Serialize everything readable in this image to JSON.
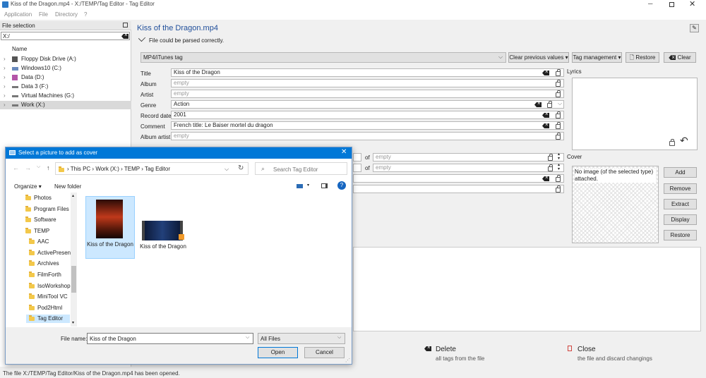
{
  "window": {
    "title": "Kiss of the Dragon.mp4 - X:/TEMP/Tag Editor - Tag Editor"
  },
  "menu": {
    "items": [
      "Application",
      "File",
      "Directory",
      "?"
    ]
  },
  "file_selection": {
    "title": "File selection",
    "path": "X:/",
    "column": "Name",
    "items": [
      {
        "label": "Floppy Disk Drive (A:)"
      },
      {
        "label": "Windows10 (C:)"
      },
      {
        "label": "Data (D:)"
      },
      {
        "label": "Data 3 (F:)"
      },
      {
        "label": "Virtual Machines (G:)"
      },
      {
        "label": "Work (X:)"
      }
    ]
  },
  "editor": {
    "filename": "Kiss of the Dragon.mp4",
    "parse_status": "File could be parsed correctly.",
    "tag_type": "MP4/iTunes tag",
    "buttons": {
      "clear_previous": "Clear previous values",
      "tag_management": "Tag management",
      "restore": "Restore",
      "clear": "Clear"
    },
    "fields": [
      {
        "label": "Title",
        "value": "Kiss of the Dragon"
      },
      {
        "label": "Album",
        "value": "empty"
      },
      {
        "label": "Artist",
        "value": "empty"
      },
      {
        "label": "Genre",
        "value": "Action"
      },
      {
        "label": "Record date",
        "value": "2001"
      },
      {
        "label": "Comment",
        "value": "French title: Le Baiser mortel du dragon"
      },
      {
        "label": "Album artist",
        "value": "empty"
      }
    ],
    "of_label": "of",
    "empty": "empty",
    "lyrics_label": "Lyrics",
    "cover": {
      "label": "Cover",
      "no_image": "No image (of the selected type) attached.",
      "buttons": [
        "Add",
        "Remove",
        "Extract",
        "Display",
        "Restore"
      ]
    },
    "delete": {
      "title": "Delete",
      "subtitle": "all tags from the file"
    },
    "close": {
      "title": "Close",
      "subtitle": "the file and discard changings"
    }
  },
  "status_bar": "The file X:/TEMP/Tag Editor/Kiss of the Dragon.mp4 has been opened.",
  "dialog": {
    "title": "Select a picture to add as cover",
    "breadcrumb": [
      "This PC",
      "Work (X:)",
      "TEMP",
      "Tag Editor"
    ],
    "search_placeholder": "Search Tag Editor",
    "organize": "Organize",
    "new_folder": "New folder",
    "folders": [
      "Photos",
      "Program Files",
      "Software",
      "TEMP",
      "AAC",
      "ActivePresent",
      "Archives",
      "FilmForth",
      "IsoWorkshop",
      "MiniTool VC",
      "Pod2Html",
      "Tag Editor"
    ],
    "files": [
      {
        "name": "Kiss of the Dragon",
        "selected": true
      },
      {
        "name": "Kiss of the Dragon",
        "selected": false
      }
    ],
    "file_name_label": "File name:",
    "file_name_value": "Kiss of the Dragon",
    "file_type": "All Files",
    "open": "Open",
    "cancel": "Cancel"
  },
  "colors": {
    "accent": "#0078d7",
    "title_blue": "#1f4e9a",
    "selected": "#cce8ff"
  }
}
